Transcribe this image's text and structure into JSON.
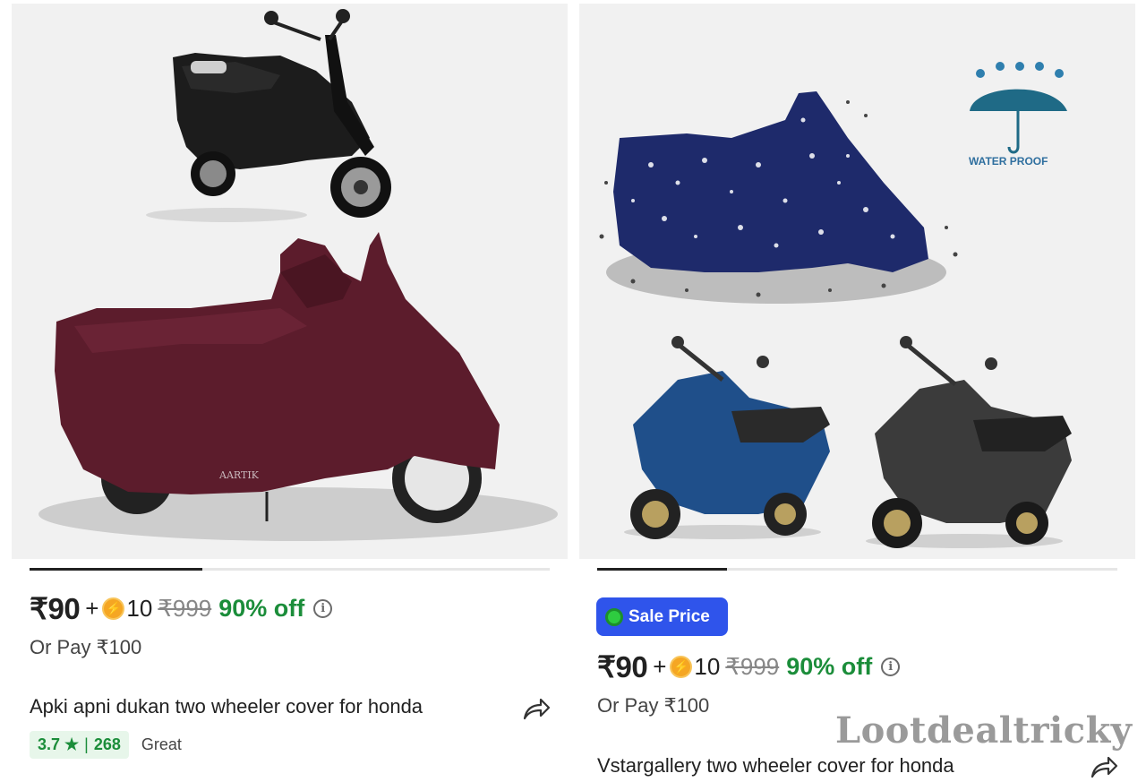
{
  "products": [
    {
      "price": "₹90",
      "plus": "+",
      "coins": "10",
      "mrp": "₹999",
      "discount": "90% off",
      "or_pay": "Or Pay ₹100",
      "title": "Apki apni dukan two wheeler cover for honda",
      "rating": "3.7 ★",
      "rating_sep": "|",
      "reviews": "268",
      "rating_label": "Great",
      "brand_mark": "AARTIK"
    },
    {
      "sale_badge": "Sale Price",
      "price": "₹90",
      "plus": "+",
      "coins": "10",
      "mrp": "₹999",
      "discount": "90% off",
      "or_pay": "Or Pay ₹100",
      "title": "Vstargallery two wheeler cover for honda",
      "waterproof_label": "WATER PROOF"
    }
  ],
  "watermark": "Lootdealtricky",
  "icons": {
    "coin": "lightning-coin-icon",
    "info": "info-icon",
    "share": "share-icon",
    "umbrella": "umbrella-icon"
  },
  "colors": {
    "discount_green": "#1b8d3a",
    "sale_badge_blue": "#2f54eb",
    "coin_orange": "#f5a623",
    "cover_maroon": "#5c1c2c",
    "cover_navy": "#1e2a6b"
  }
}
